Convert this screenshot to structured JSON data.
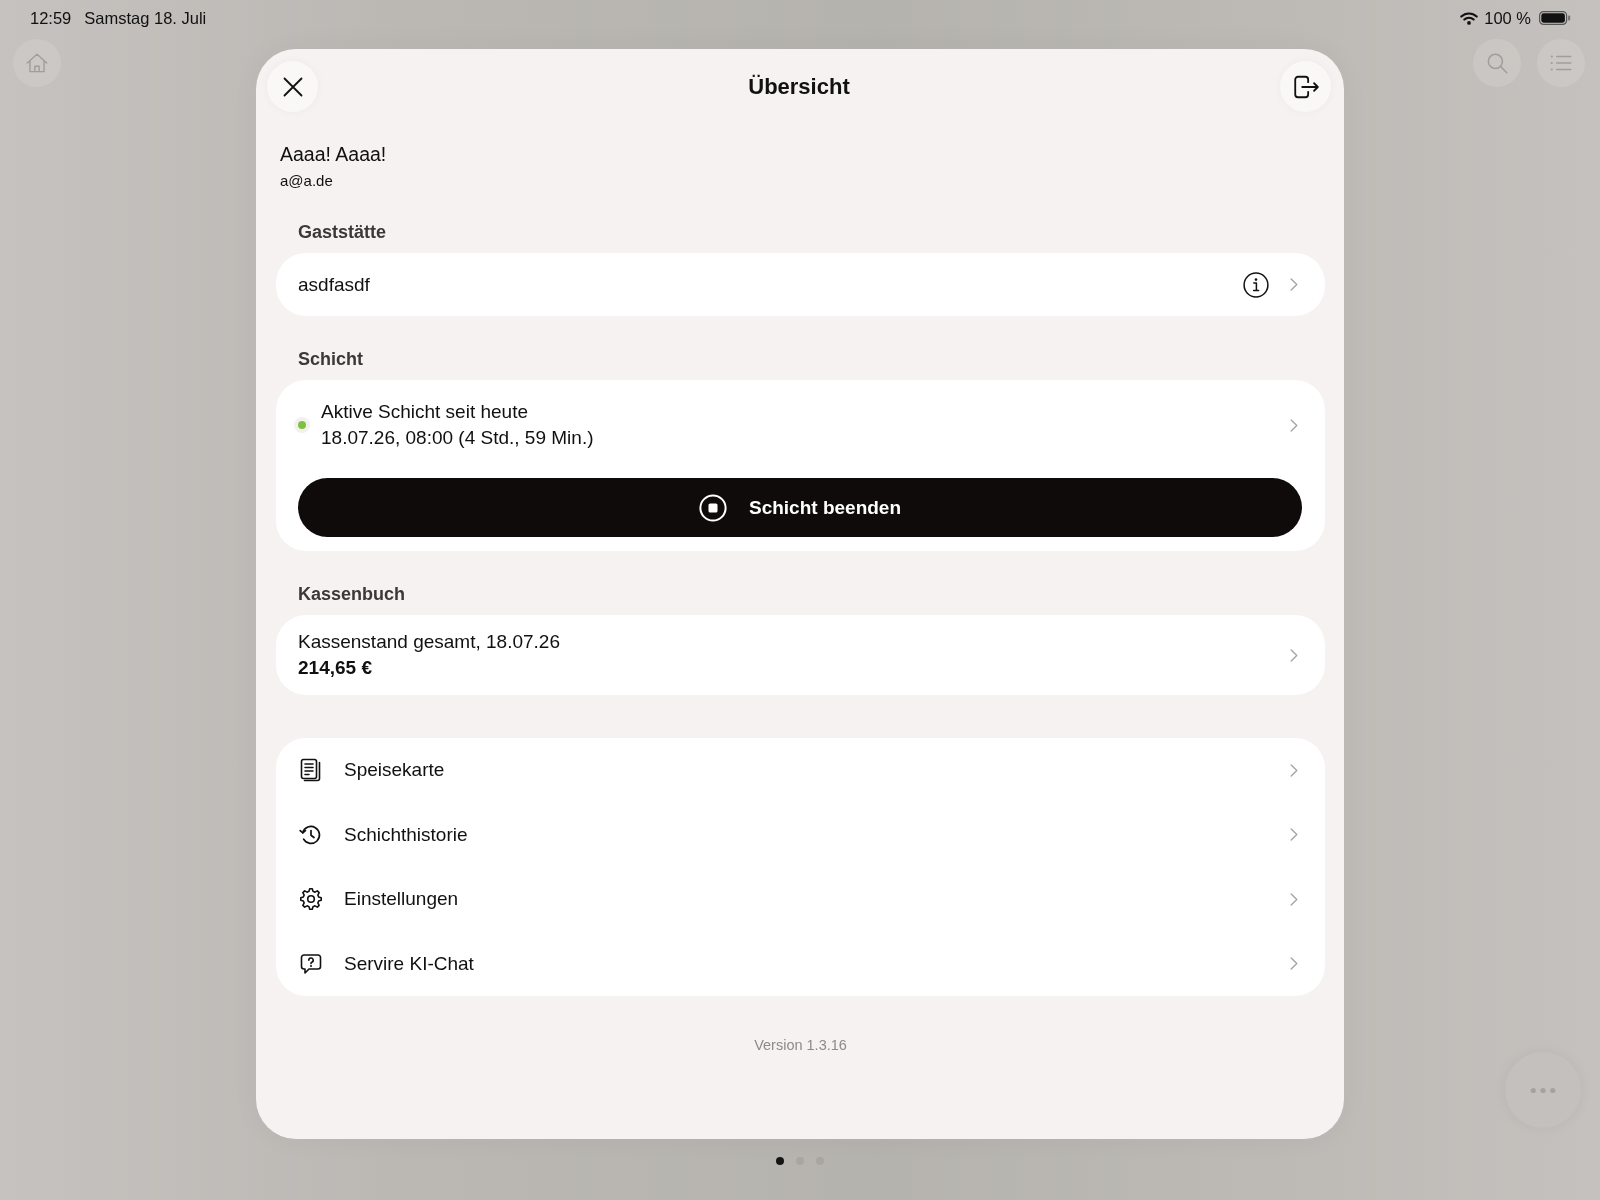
{
  "status_bar": {
    "time": "12:59",
    "date": "Samstag 18. Juli",
    "battery": "100 %"
  },
  "overview": {
    "title": "Übersicht",
    "user": {
      "name": "Aaaa! Aaaa!",
      "email": "a@a.de"
    },
    "venue": {
      "heading": "Gaststätte",
      "name": "asdfasdf"
    },
    "shift": {
      "heading": "Schicht",
      "active": true,
      "status": "Aktive Schicht seit heute",
      "since": "18.07.26, 08:00 (4 Std., 59 Min.)",
      "end_button": "Schicht beenden"
    },
    "cashbook": {
      "heading": "Kassenbuch",
      "label": "Kassenstand gesamt, 18.07.26",
      "amount": "214,65 €"
    },
    "menu": [
      {
        "kind": "document",
        "label": "Speisekarte"
      },
      {
        "kind": "history",
        "label": "Schichthistorie"
      },
      {
        "kind": "settings",
        "label": "Einstellungen"
      },
      {
        "kind": "chat",
        "label": "Servire KI-Chat"
      }
    ],
    "version": "Version 1.3.16"
  },
  "page_dots": [
    {
      "selected": true
    },
    {
      "selected": false
    },
    {
      "selected": false
    }
  ]
}
